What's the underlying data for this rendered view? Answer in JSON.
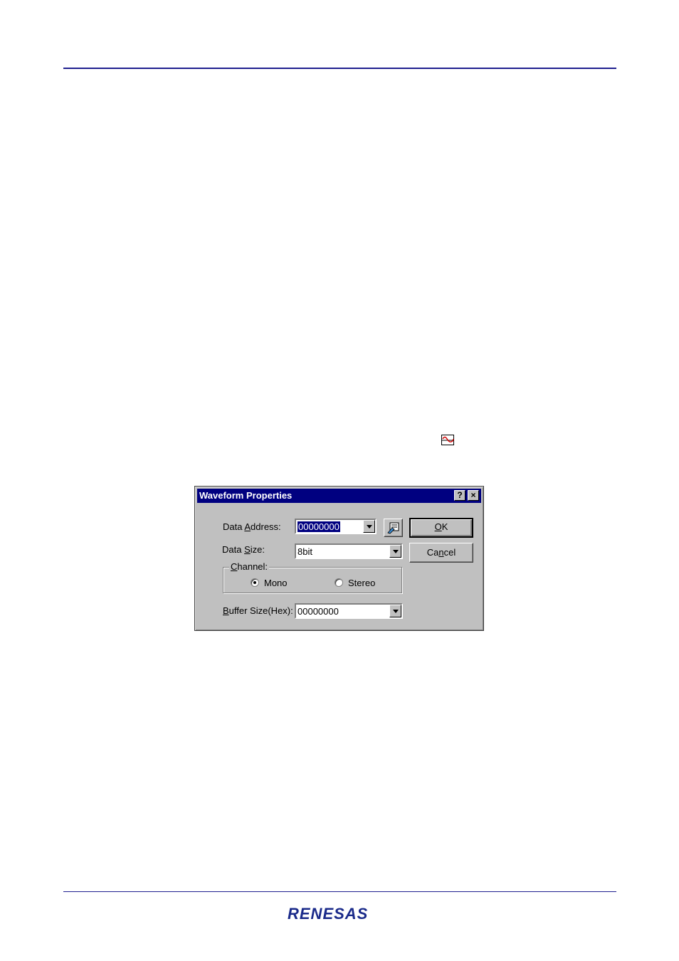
{
  "page": {
    "footer_logo": "RENESAS",
    "inline_icon": "waveform-icon"
  },
  "dialog": {
    "title": "Waveform Properties",
    "help_button": "?",
    "close_button": "×",
    "data_address": {
      "label_pre": "Data ",
      "label_accel": "A",
      "label_post": "ddress:",
      "value": "00000000"
    },
    "browse_icon": "browse-address-icon",
    "ok": {
      "accel": "O",
      "rest": "K"
    },
    "cancel": {
      "pre": "Ca",
      "accel": "n",
      "post": "cel"
    },
    "data_size": {
      "label_pre": "Data ",
      "label_accel": "S",
      "label_post": "ize:",
      "value": "8bit"
    },
    "channel": {
      "legend_accel": "C",
      "legend_rest": "hannel:",
      "mono": "Mono",
      "stereo": "Stereo",
      "selected": "Mono"
    },
    "buffer_size": {
      "label_accel": "B",
      "label_rest": "uffer Size(Hex):",
      "value": "00000000"
    }
  },
  "colors": {
    "titlebar": "#000080",
    "dialog_face": "#c0c0c0",
    "rule": "#1f1f8f"
  }
}
